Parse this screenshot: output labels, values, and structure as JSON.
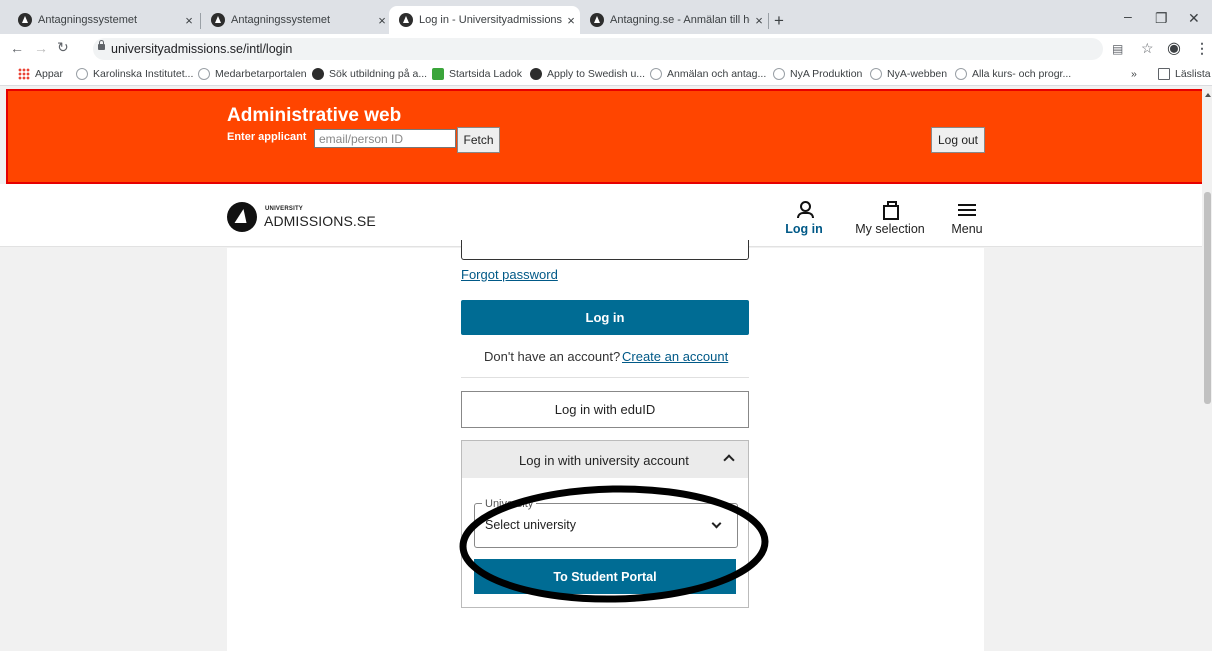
{
  "browser": {
    "tabs": [
      {
        "title": "Antagningssystemet",
        "active": false
      },
      {
        "title": "Antagningssystemet",
        "active": false
      },
      {
        "title": "Log in - Universityadmissions.se",
        "active": true
      },
      {
        "title": "Antagning.se - Anmälan till högs",
        "active": false
      }
    ],
    "new_tab": "+",
    "close_glyph": "×",
    "url": "universityadmissions.se/intl/login",
    "bookmarks": [
      {
        "label": "Appar",
        "icon": "apps-icon"
      },
      {
        "label": "Karolinska Institutet...",
        "icon": "globe-icon"
      },
      {
        "label": "Medarbetarportalen",
        "icon": "globe-icon"
      },
      {
        "label": "Sök utbildning på a...",
        "icon": "ua-logo-icon"
      },
      {
        "label": "Startsida Ladok",
        "icon": "ladok-icon"
      },
      {
        "label": "Apply to Swedish u...",
        "icon": "ua-logo-icon"
      },
      {
        "label": "Anmälan och antag...",
        "icon": "globe-icon"
      },
      {
        "label": "NyA Produktion",
        "icon": "globe-icon"
      },
      {
        "label": "NyA-webben",
        "icon": "globe-icon"
      },
      {
        "label": "Alla kurs- och progr...",
        "icon": "globe-icon"
      }
    ],
    "more_bookmarks": "»",
    "reading_list": "Läslista"
  },
  "admin": {
    "title": "Administrative web",
    "enter_label": "Enter applicant",
    "applicant_placeholder": "email/person ID",
    "fetch_label": "Fetch",
    "logout_label": "Log out",
    "bg_color": "#ff4500"
  },
  "header": {
    "logo_small": "UNIVERSITY",
    "logo_main": "ADMISSIONS.SE",
    "nav": {
      "login": "Log in",
      "selection": "My selection",
      "menu": "Menu"
    }
  },
  "login": {
    "forgot_password": "Forgot password",
    "login_button": "Log in",
    "no_account": "Don't have an account?",
    "create_account": "Create an account",
    "eduid_button": "Log in with eduID",
    "university_section": {
      "title": "Log in with university account",
      "select_legend": "University",
      "select_value": "Select university",
      "portal_button": "To Student Portal"
    },
    "accent_color": "#006c94"
  }
}
